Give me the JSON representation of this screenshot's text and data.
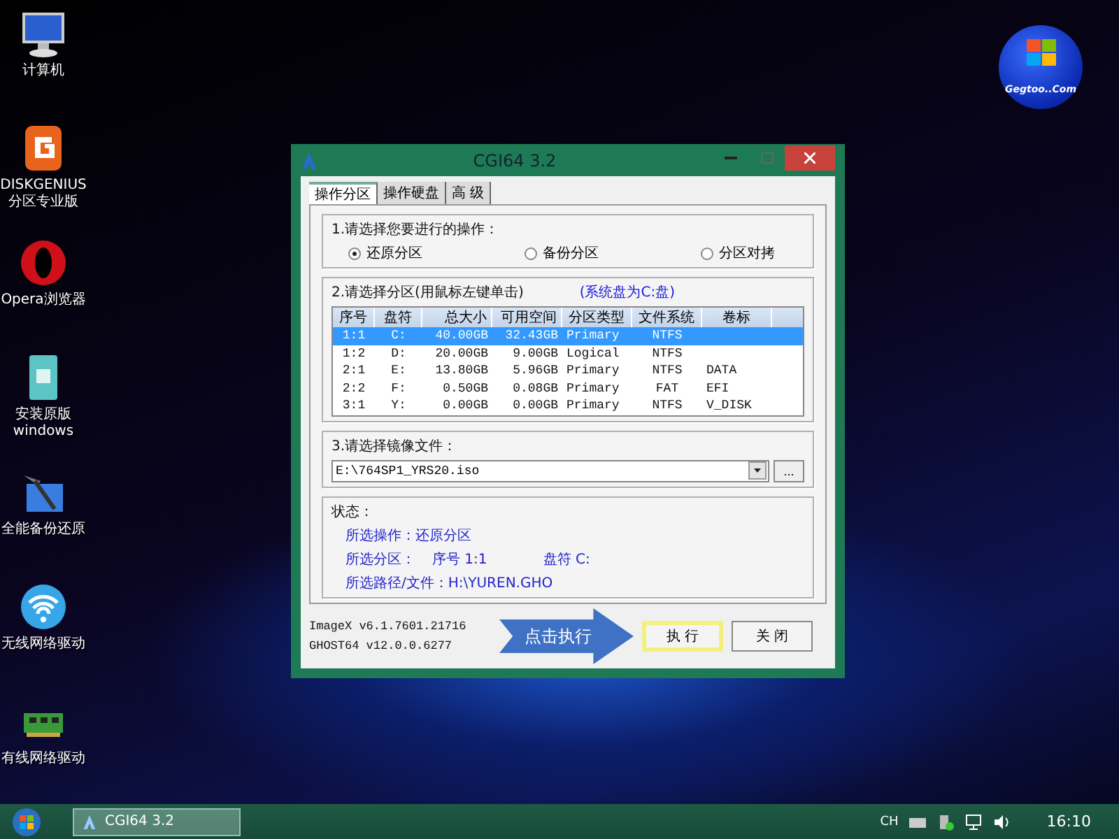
{
  "desktop_icons": [
    {
      "label": "计算机",
      "kind": "computer"
    },
    {
      "label": "DISKGENIUS\n分区专业版",
      "kind": "diskgenius"
    },
    {
      "label": "Opera浏览器",
      "kind": "opera"
    },
    {
      "label": "安装原版\nwindows",
      "kind": "install"
    },
    {
      "label": "全能备份还原",
      "kind": "backup"
    },
    {
      "label": "无线网络驱动",
      "kind": "wifi"
    },
    {
      "label": "有线网络驱动",
      "kind": "nic"
    }
  ],
  "logo": {
    "text": "Gegtoo..Com"
  },
  "window": {
    "title": "CGI64  3.2",
    "tabs": [
      {
        "label": "操作分区",
        "selected": true
      },
      {
        "label": "操作硬盘",
        "selected": false
      },
      {
        "label": "高 级",
        "selected": false
      }
    ],
    "operation": {
      "title": "1.请选择您要进行的操作：",
      "options": [
        {
          "label": "还原分区",
          "selected": true
        },
        {
          "label": "备份分区",
          "selected": false
        },
        {
          "label": "分区对拷",
          "selected": false
        }
      ]
    },
    "partition": {
      "title": "2.请选择分区(用鼠标左键单击)",
      "note": "(系统盘为C:盘)",
      "columns": [
        "序号",
        "盘符",
        "总大小",
        "可用空间",
        "分区类型",
        "文件系统",
        "卷标"
      ],
      "rows": [
        {
          "cells": [
            "1:1",
            "C:",
            "40.00GB",
            "32.43GB",
            "Primary",
            "NTFS",
            ""
          ],
          "selected": true
        },
        {
          "cells": [
            "1:2",
            "D:",
            "20.00GB",
            "9.00GB",
            "Logical",
            "NTFS",
            ""
          ],
          "selected": false
        },
        {
          "cells": [
            "2:1",
            "E:",
            "13.80GB",
            "5.96GB",
            "Primary",
            "NTFS",
            "DATA"
          ],
          "selected": false
        },
        {
          "cells": [
            "2:2",
            "F:",
            "0.50GB",
            "0.08GB",
            "Primary",
            "FAT",
            "EFI"
          ],
          "selected": false
        },
        {
          "cells": [
            "3:1",
            "Y:",
            "0.00GB",
            "0.00GB",
            "Primary",
            "NTFS",
            "V_DISK"
          ],
          "selected": false
        }
      ]
    },
    "image_file": {
      "title": "3.请选择镜像文件：",
      "value": "E:\\764SP1_YRS20.iso",
      "browse": "..."
    },
    "status": {
      "title": "状态：",
      "operation": "所选操作：还原分区",
      "partition_label": "所选分区：",
      "partition_index": "序号 1:1",
      "partition_drive": "盘符 C:",
      "path": "所选路径/文件：H:\\YUREN.GHO"
    },
    "versions": [
      "ImageX v6.1.7601.21716",
      "GHOST64 v12.0.0.6277"
    ],
    "callout": "点击执行",
    "buttons": [
      {
        "label": "执 行",
        "highlighted": true
      },
      {
        "label": "关 闭",
        "highlighted": false
      }
    ]
  },
  "taskbar": {
    "task": "CGI64  3.2",
    "language": "CH",
    "clock": "16:10"
  }
}
